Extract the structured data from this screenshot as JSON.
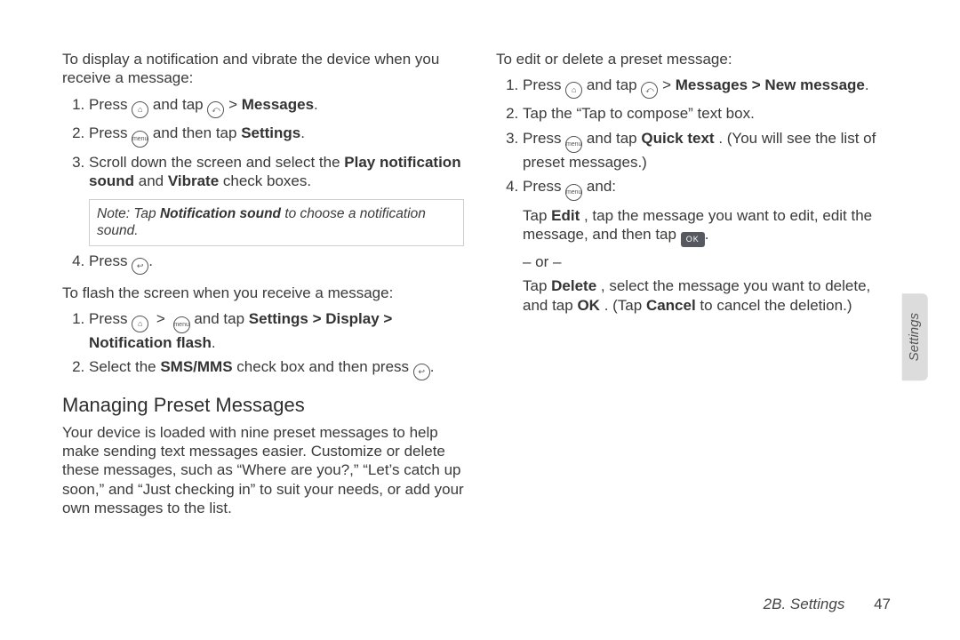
{
  "left": {
    "intro1": "To display a notification and vibrate the device when you receive a message:",
    "l1a": "Press ",
    "l1b": " and tap ",
    "l1c": " > ",
    "l1_msgs": "Messages",
    "l1_dot": ".",
    "l2a": "Press ",
    "l2b": " and then tap ",
    "l2_settings": "Settings",
    "l2_dot": ".",
    "l3a": "Scroll down the screen and select the ",
    "l3_play": "Play notification sound",
    "l3_and": " and ",
    "l3_vib": "Vibrate",
    "l3b": " check boxes.",
    "note_pre": "Note:",
    "note_a": " Tap ",
    "note_ns": "Notification sound",
    "note_b": " to choose a notification sound.",
    "l4a": "Press ",
    "l4_dot": ".",
    "intro2": "To flash the screen when you receive a message:",
    "f1a": "Press ",
    "f1c": " and tap ",
    "f1_sd": "Settings > Display > Notification flash",
    "f1_dot": ".",
    "f2a": "Select the ",
    "f2_sms": "SMS/MMS",
    "f2b": " check box and then press ",
    "f2_dot": ".",
    "h3": "Managing Preset Messages",
    "preset_body": "Your device is loaded with nine preset messages to help make sending text messages easier. Customize or delete these messages, such as “Where are you?,” “Let’s catch up soon,” and “Just checking in” to suit your needs, or add your own messages to the list."
  },
  "right": {
    "intro": "To edit or delete a preset message:",
    "r1a": "Press ",
    "r1b": " and tap ",
    "r1c": " > ",
    "r1_path": "Messages > New message",
    "r1_dot": ".",
    "r2": "Tap the “Tap to compose” text box.",
    "r3a": "Press ",
    "r3b": " and tap ",
    "r3_qt": "Quick text",
    "r3c": ". (You will see the list of preset messages.)",
    "r4a": "Press ",
    "r4b": " and:",
    "r4_edit_a": "Tap ",
    "r4_edit": "Edit",
    "r4_edit_b": ", tap the message you want to edit, edit the message, and then tap ",
    "r4_edit_dot": ".",
    "or": "– or –",
    "r4_del_a": "Tap ",
    "r4_del": "Delete",
    "r4_del_b": ", select the message you want to delete, and tap ",
    "r4_ok": "OK",
    "r4_del_c": ". (Tap ",
    "r4_cancel": "Cancel",
    "r4_del_d": " to cancel the deletion.)"
  },
  "side_tab": "Settings",
  "footer_section": "2B. Settings",
  "footer_page": "47",
  "icons": {
    "home": "⌂",
    "menu": "menu",
    "back": "↩",
    "gt": ">",
    "ok": "OK",
    "also": "⤺"
  }
}
